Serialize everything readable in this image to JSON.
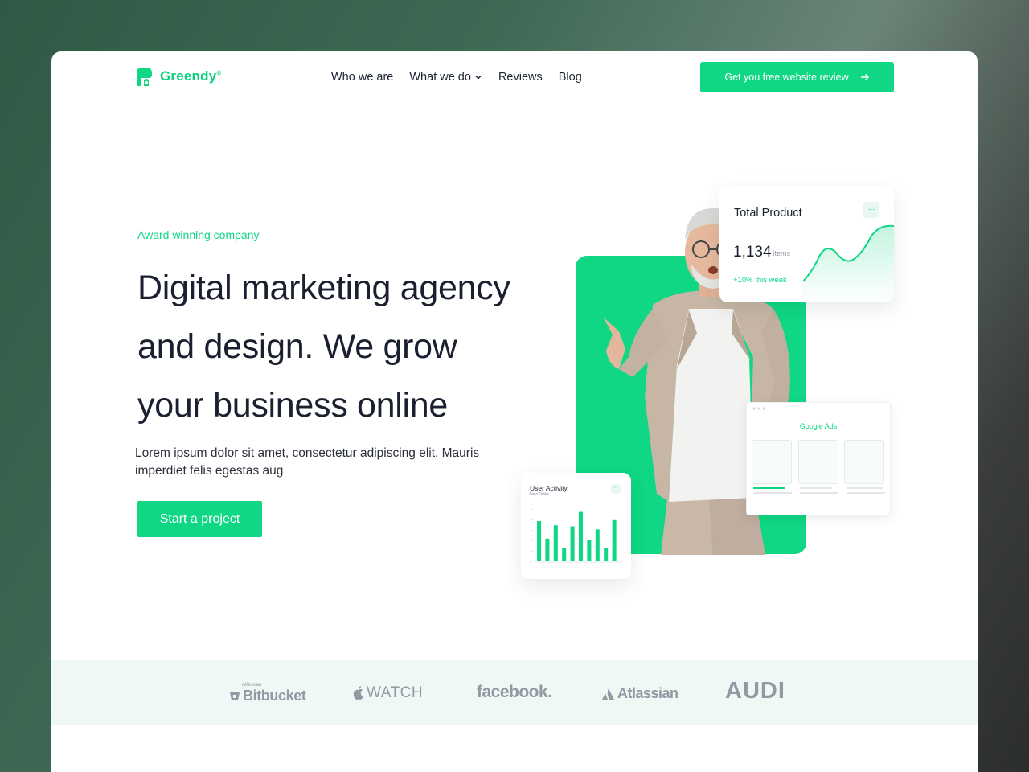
{
  "brand": {
    "name": "Greendy",
    "mark": "®"
  },
  "nav": {
    "items": [
      {
        "label": "Who we are"
      },
      {
        "label": "What we do",
        "has_dropdown": true
      },
      {
        "label": "Reviews"
      },
      {
        "label": "Blog"
      }
    ],
    "cta_label": "Get you free website review"
  },
  "hero": {
    "eyebrow": "Award winning company",
    "headline": "Digital marketing agency and design. We grow your business online",
    "subtext": "Lorem ipsum dolor sit amet, consectetur adipiscing elit. Mauris imperdiet felis egestas aug",
    "button_label": "Start a project"
  },
  "cards": {
    "total_product": {
      "title": "Total Product",
      "more": "...",
      "value": "1,134",
      "unit": "Items",
      "change": "+10% this week"
    },
    "google_ads": {
      "title": "Google Ads"
    },
    "user_activity": {
      "title": "User Activity",
      "subtitle": "New Tasks",
      "more": "...",
      "bars": [
        0.78,
        0.44,
        0.7,
        0.26,
        0.68,
        0.96,
        0.42,
        0.62,
        0.26,
        0.8
      ]
    }
  },
  "logos": {
    "bitbucket_small": "Atlassian",
    "bitbucket": "Bitbucket",
    "watch": "WATCH",
    "facebook": "facebook.",
    "atlassian": "Atlassian",
    "audi": "AUDI"
  },
  "colors": {
    "accent": "#0fd784",
    "text": "#1a2030",
    "logo_gray": "#9199a3",
    "logo_band": "#eff8f4"
  }
}
